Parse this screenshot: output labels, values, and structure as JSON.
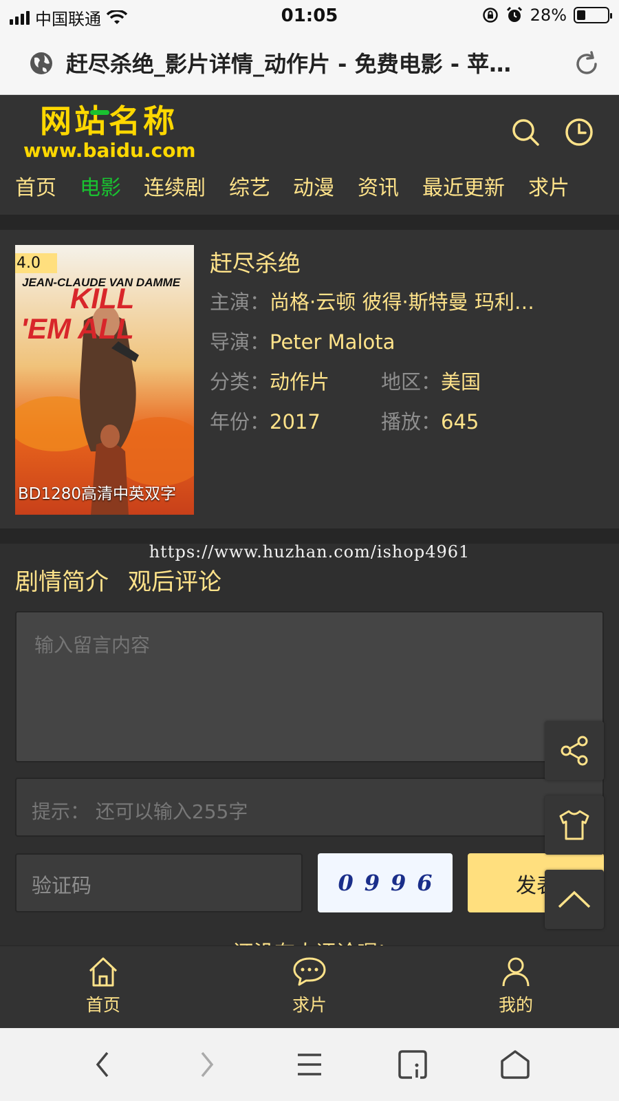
{
  "status_bar": {
    "carrier": "中国联通",
    "time": "01:05",
    "battery_percent": "28%",
    "battery_level": 0.28
  },
  "browser": {
    "page_title": "赶尽杀绝_影片详情_动作片 - 免费电影 - 苹…"
  },
  "site": {
    "logo_name": "网站名称",
    "logo_url": "www.baidu.com",
    "nav": [
      "首页",
      "电影",
      "连续剧",
      "综艺",
      "动漫",
      "资讯",
      "最近更新",
      "求片"
    ],
    "active_nav": "电影",
    "accent_color": "#ffe38a",
    "active_color": "#19c130"
  },
  "movie": {
    "score": "4.0",
    "quality": "BD1280高清中英双字",
    "title": "赶尽杀绝",
    "cast_label": "主演：",
    "cast": "尚格·云顿 彼得·斯特曼 玛利…",
    "director_label": "导演：",
    "director": "Peter Malota",
    "category_label": "分类：",
    "category": "动作片",
    "region_label": "地区：",
    "region": "美国",
    "year_label": "年份：",
    "year": "2017",
    "plays_label": "播放：",
    "plays": "645",
    "poster_actor": "JEAN-CLAUDE VAN DAMME",
    "poster_title_1": "KILL",
    "poster_title_2": "'EM ALL"
  },
  "comments": {
    "watermark": "https://www.huzhan.com/ishop4961",
    "tab_synopsis": "剧情简介",
    "tab_reviews": "观后评论",
    "placeholder": "输入留言内容",
    "hint": "提示：  还可以输入255字",
    "captcha_placeholder": "验证码",
    "captcha_chars": [
      "0",
      "9",
      "9",
      "6"
    ],
    "submit": "发表",
    "empty_text": "还没有人评论喔!"
  },
  "tabbar": {
    "home": "首页",
    "request": "求片",
    "mine": "我的"
  }
}
